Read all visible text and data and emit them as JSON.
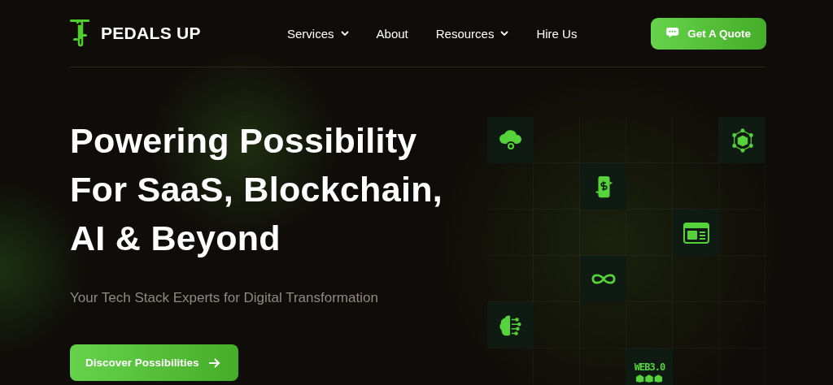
{
  "brand": {
    "name": "PEDALS UP"
  },
  "nav": [
    {
      "label": "Services",
      "dropdown": true
    },
    {
      "label": "About",
      "dropdown": false
    },
    {
      "label": "Resources",
      "dropdown": true
    },
    {
      "label": "Hire Us",
      "dropdown": false
    }
  ],
  "cta": {
    "label": "Get A Quote"
  },
  "hero": {
    "title_lines": [
      "Powering Possibility",
      "For SaaS, Blockchain,",
      "AI & Beyond"
    ],
    "subtitle": "Your Tech Stack Experts for Digital Transformation",
    "button": "Discover Possibilities"
  },
  "grid": [
    [
      {
        "kind": "cloud"
      },
      {
        "kind": "empty"
      },
      {
        "kind": "empty"
      },
      {
        "kind": "empty"
      },
      {
        "kind": "empty"
      },
      {
        "kind": "cube"
      }
    ],
    [
      {
        "kind": "empty"
      },
      {
        "kind": "empty"
      },
      {
        "kind": "payment"
      },
      {
        "kind": "empty"
      },
      {
        "kind": "empty"
      },
      {
        "kind": "empty"
      }
    ],
    [
      {
        "kind": "empty"
      },
      {
        "kind": "empty"
      },
      {
        "kind": "empty"
      },
      {
        "kind": "empty"
      },
      {
        "kind": "browser"
      },
      {
        "kind": "empty"
      }
    ],
    [
      {
        "kind": "empty"
      },
      {
        "kind": "empty"
      },
      {
        "kind": "infinity"
      },
      {
        "kind": "empty"
      },
      {
        "kind": "empty"
      },
      {
        "kind": "empty"
      }
    ],
    [
      {
        "kind": "brain"
      },
      {
        "kind": "empty"
      },
      {
        "kind": "empty"
      },
      {
        "kind": "empty"
      },
      {
        "kind": "empty"
      },
      {
        "kind": "empty"
      }
    ],
    [
      {
        "kind": "empty"
      },
      {
        "kind": "empty"
      },
      {
        "kind": "empty"
      },
      {
        "kind": "web3"
      },
      {
        "kind": "empty"
      },
      {
        "kind": "empty"
      }
    ]
  ],
  "web3_label": "WEB3.0"
}
